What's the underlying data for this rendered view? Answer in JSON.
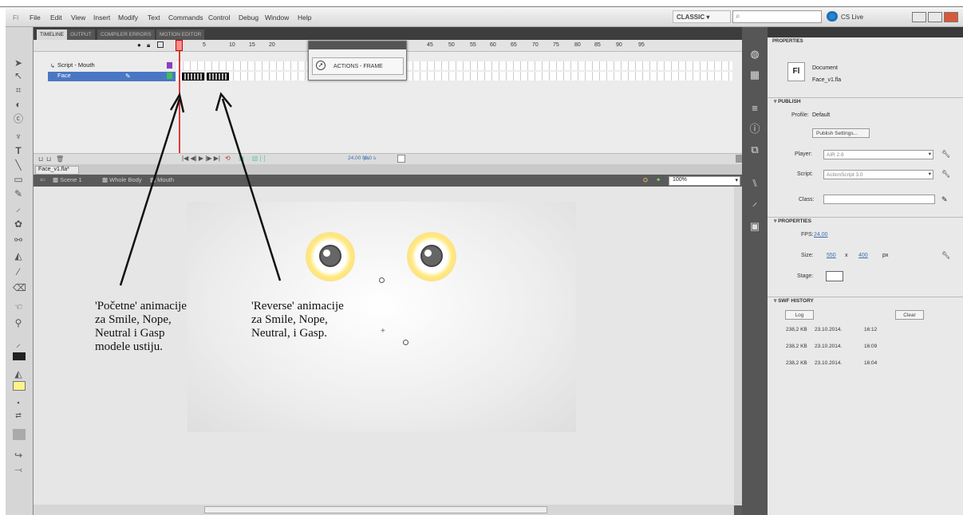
{
  "menubar": {
    "logo": "Fl",
    "items": [
      "File",
      "Edit",
      "View",
      "Insert",
      "Modify",
      "Text",
      "Commands",
      "Control",
      "Debug",
      "Window",
      "Help"
    ],
    "workspace": "CLASSIC ▾",
    "search_icon": "magnifier-icon",
    "cs_live": "CS Live"
  },
  "timeline": {
    "tabs": [
      "TIMELINE",
      "OUTPUT",
      "COMPILER ERRORS",
      "MOTION EDITOR"
    ],
    "frame_numbers": [
      "1",
      "5",
      "10",
      "15",
      "20",
      "45",
      "50",
      "55",
      "60",
      "65",
      "70",
      "75",
      "80",
      "85",
      "90",
      "95"
    ],
    "layers": [
      {
        "name": "Script - Mouth",
        "color": "#8a3fc2"
      },
      {
        "name": "Face",
        "color": "#3fbf5a"
      }
    ],
    "fps": "24,00 fps",
    "time": "0,0 s"
  },
  "actions_panel": {
    "label": "ACTIONS - FRAME"
  },
  "document": {
    "tab": "Face_v1.fla*",
    "breadcrumbs": [
      "Scene 1",
      "Whole Body",
      "Mouth"
    ],
    "zoom": "100%"
  },
  "annotations": {
    "left": [
      "'Početne' animacije",
      "za Smile, Nope,",
      "Neutral i Gasp",
      "modele ustiju."
    ],
    "right": [
      "'Reverse' animacije",
      "za Smile, Nope,",
      "Neutral, i Gasp."
    ]
  },
  "properties": {
    "tab": "PROPERTIES",
    "doc_type": "Document",
    "doc_name": "Face_v1.fla",
    "doc_icon": "Fl",
    "publish": {
      "header": "PUBLISH",
      "profile_label": "Profile:",
      "profile_value": "Default",
      "settings_button": "Publish Settings...",
      "player_label": "Player:",
      "player_value": "AIR 2.6",
      "script_label": "Script:",
      "script_value": "ActionScript 3.0",
      "class_label": "Class:"
    },
    "props": {
      "header": "PROPERTIES",
      "fps_label": "FPS:",
      "fps_value": "24,00",
      "size_label": "Size:",
      "width": "550",
      "x": "x",
      "height": "400",
      "unit": "px",
      "stage_label": "Stage:"
    },
    "history": {
      "header": "SWF HISTORY",
      "log_button": "Log",
      "clear_button": "Clear",
      "rows": [
        {
          "size": "238,2 KB",
          "date": "23.10.2014.",
          "time": "16:12"
        },
        {
          "size": "238,2 KB",
          "date": "23.10.2014.",
          "time": "16:09"
        },
        {
          "size": "238,2 KB",
          "date": "23.10.2014.",
          "time": "16:04"
        }
      ]
    }
  }
}
